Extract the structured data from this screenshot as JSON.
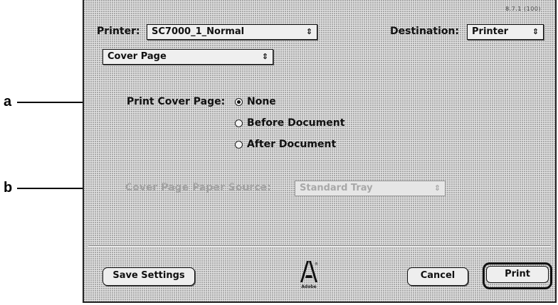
{
  "callouts": {
    "a": "a",
    "b": "b"
  },
  "dialog": {
    "version": "8.7.1 (100)",
    "printer_label": "Printer:",
    "printer_value": "SC7000_1_Normal",
    "destination_label": "Destination:",
    "destination_value": "Printer",
    "panel_value": "Cover Page",
    "print_cover_label": "Print Cover Page:",
    "radio_options": [
      {
        "label": "None",
        "selected": true
      },
      {
        "label": "Before Document",
        "selected": false
      },
      {
        "label": "After Document",
        "selected": false
      }
    ],
    "paper_source_label": "Cover Page Paper Source:",
    "paper_source_value": "Standard Tray",
    "popup_arrows": "⇕"
  },
  "buttons": {
    "save": "Save Settings",
    "cancel": "Cancel",
    "print": "Print"
  },
  "logo": {
    "word": "Adobe"
  },
  "colors": {
    "dialog_bg": "#e2e2e2",
    "disabled_text": "#a3a3a3"
  }
}
